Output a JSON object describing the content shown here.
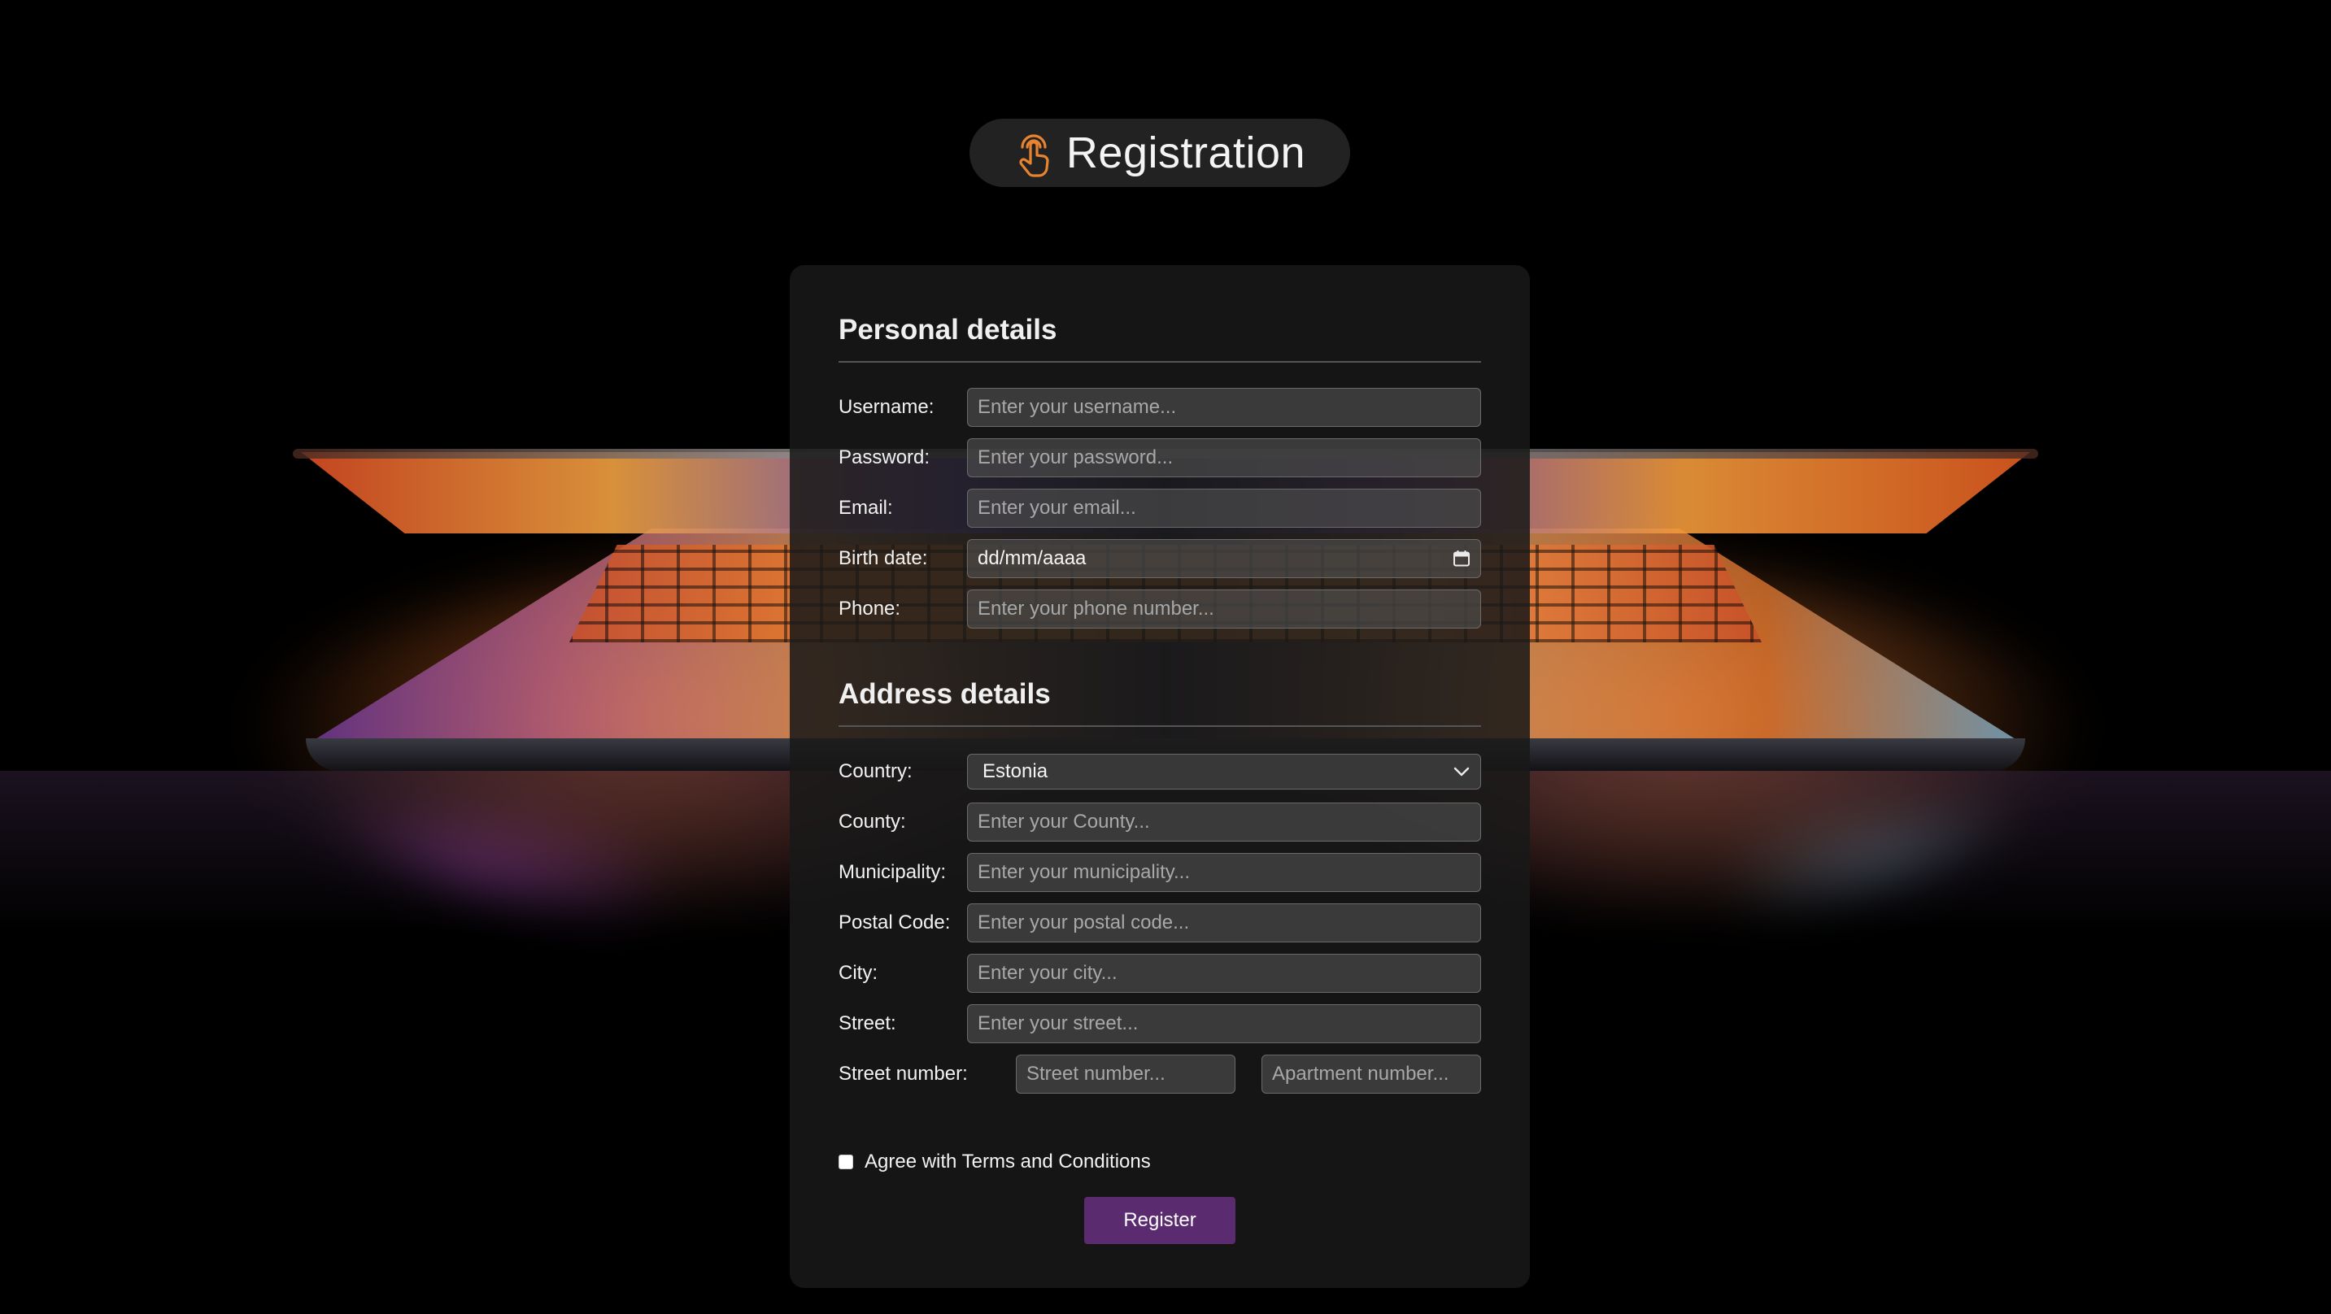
{
  "header": {
    "title": "Registration",
    "icon": "touch-hand-icon",
    "icon_color": "#e8832f"
  },
  "personal": {
    "title": "Personal details",
    "username": {
      "label": "Username:",
      "placeholder": "Enter your username..."
    },
    "password": {
      "label": "Password:",
      "placeholder": "Enter your password..."
    },
    "email": {
      "label": "Email:",
      "placeholder": "Enter your email..."
    },
    "birth_date": {
      "label": "Birth date:",
      "value": "dd/mm/aaaa",
      "icon": "calendar-icon"
    },
    "phone": {
      "label": "Phone:",
      "placeholder": "Enter your phone number..."
    }
  },
  "address": {
    "title": "Address details",
    "country": {
      "label": "Country:",
      "value": "Estonia",
      "icon": "chevron-down-icon"
    },
    "county": {
      "label": "County:",
      "placeholder": "Enter your County..."
    },
    "municipality": {
      "label": "Municipality:",
      "placeholder": "Enter your municipality..."
    },
    "postal_code": {
      "label": "Postal Code:",
      "placeholder": "Enter your postal code..."
    },
    "city": {
      "label": "City:",
      "placeholder": "Enter your city..."
    },
    "street": {
      "label": "Street:",
      "placeholder": "Enter your street..."
    },
    "street_number": {
      "label": "Street number:",
      "number_placeholder": "Street number...",
      "apartment_placeholder": "Apartment number..."
    }
  },
  "terms": {
    "label": "Agree with Terms and Conditions",
    "checked": false
  },
  "actions": {
    "register_label": "Register",
    "register_color": "#5b2b70"
  }
}
